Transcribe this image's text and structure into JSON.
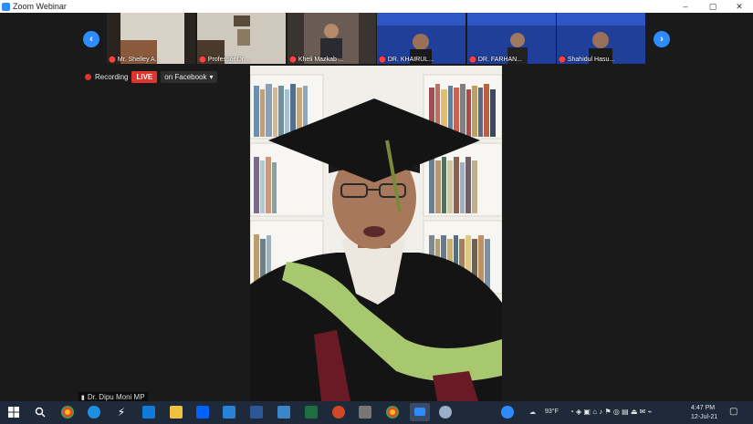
{
  "window": {
    "title": "Zoom Webinar",
    "minimize": "–",
    "maximize": "▢",
    "close": "✕"
  },
  "strip": {
    "prev": "‹",
    "next": "›",
    "participants": [
      {
        "name": "Mr. Shelley A..."
      },
      {
        "name": "Professor Dr...."
      },
      {
        "name": "Kheli Mazkab ..."
      },
      {
        "name": "DR. KHAIRUL..."
      },
      {
        "name": "DR. FARHAN..."
      },
      {
        "name": "Shahidul Hasu..."
      }
    ]
  },
  "recording": {
    "label": "Recording",
    "live": "LIVE",
    "platform": "on Facebook",
    "caret": "▾"
  },
  "speaker": {
    "name": "Dr. Dipu Moni MP"
  },
  "taskbar": {
    "weather": "93°F",
    "time": "4:47 PM",
    "date": "12-Jul-21"
  },
  "colors": {
    "accent": "#2d8cff",
    "live": "#e0342c",
    "background": "#1a1a1a",
    "taskbar": "#1e2a3a"
  }
}
